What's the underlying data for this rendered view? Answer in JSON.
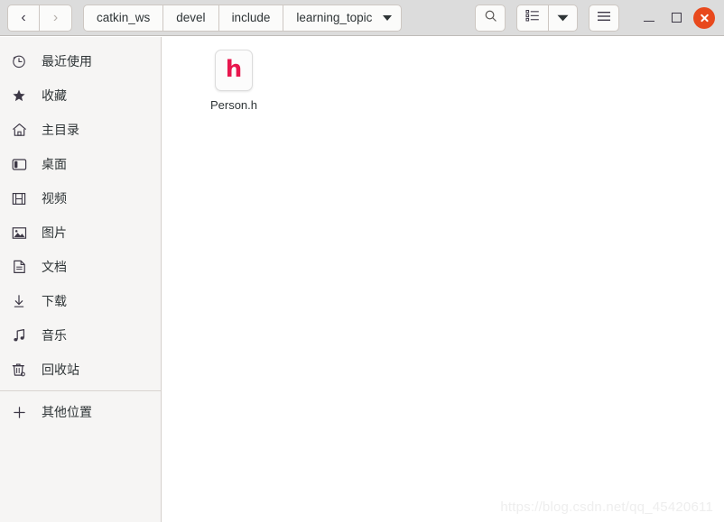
{
  "header": {
    "nav": {
      "back_label": "‹",
      "forward_label": "›",
      "back_name": "back-button",
      "forward_name": "forward-button"
    },
    "breadcrumbs": [
      {
        "label": "catkin_ws"
      },
      {
        "label": "devel"
      },
      {
        "label": "include"
      },
      {
        "label": "learning_topic"
      }
    ],
    "tools": {
      "search_icon": "search-icon",
      "list_view_icon": "list-view-icon",
      "view_dropdown_icon": "chevron-down-icon",
      "menu_icon": "hamburger-menu-icon"
    },
    "window_controls": {
      "minimize_icon": "minimize-icon",
      "maximize_icon": "maximize-icon",
      "close_icon": "close-icon",
      "close_color": "#e8491d"
    }
  },
  "sidebar": {
    "items": [
      {
        "label": "最近使用",
        "icon": "clock-icon",
        "name": "sidebar-item-recent"
      },
      {
        "label": "收藏",
        "icon": "star-icon",
        "name": "sidebar-item-starred"
      },
      {
        "label": "主目录",
        "icon": "home-icon",
        "name": "sidebar-item-home"
      },
      {
        "label": "桌面",
        "icon": "desktop-icon",
        "name": "sidebar-item-desktop"
      },
      {
        "label": "视频",
        "icon": "video-icon",
        "name": "sidebar-item-videos"
      },
      {
        "label": "图片",
        "icon": "image-icon",
        "name": "sidebar-item-pictures"
      },
      {
        "label": "文档",
        "icon": "document-icon",
        "name": "sidebar-item-documents"
      },
      {
        "label": "下载",
        "icon": "download-icon",
        "name": "sidebar-item-downloads"
      },
      {
        "label": "音乐",
        "icon": "music-icon",
        "name": "sidebar-item-music"
      },
      {
        "label": "回收站",
        "icon": "trash-icon",
        "name": "sidebar-item-trash"
      }
    ],
    "other_locations": {
      "label": "其他位置",
      "icon": "plus-icon"
    }
  },
  "main": {
    "files": [
      {
        "name": "Person.h",
        "glyph": "h",
        "glyph_color": "#e8174e"
      }
    ]
  },
  "watermark": {
    "text": "https://blog.csdn.net/qq_45420611"
  }
}
